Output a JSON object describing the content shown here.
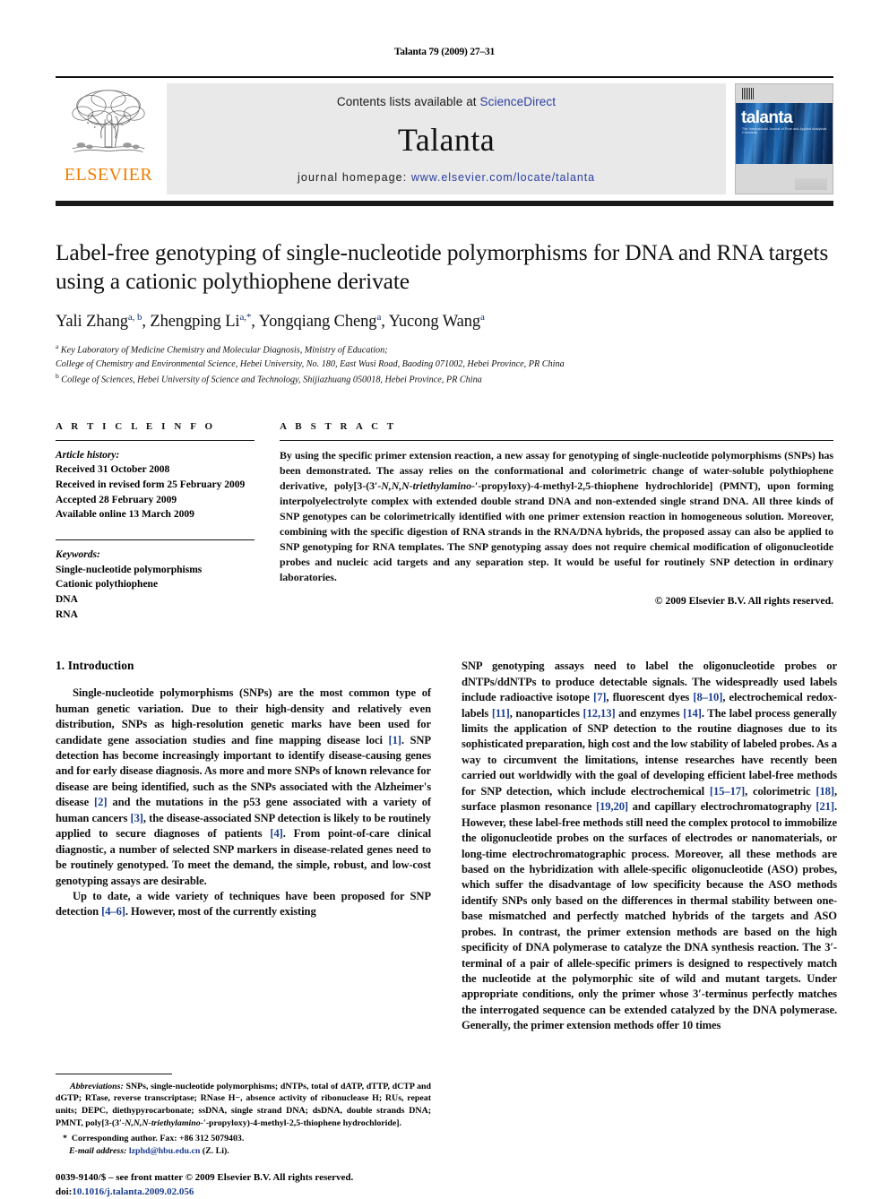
{
  "running_head": "Talanta 79 (2009) 27–31",
  "masthead": {
    "publisher_name": "ELSEVIER",
    "contents_prefix": "Contents lists available at ",
    "contents_link": "ScienceDirect",
    "journal_name": "Talanta",
    "homepage_prefix": "journal homepage: ",
    "homepage_link": "www.elsevier.com/locate/talanta",
    "cover_title": "talanta",
    "cover_subtitle": "The International Journal of Pure and Applied Analytical Chemistry",
    "link_color": "#2b3f9e",
    "elsevier_orange": "#F07D00"
  },
  "article": {
    "title": "Label-free genotyping of single-nucleotide polymorphisms for DNA and RNA targets using a cationic polythiophene derivate",
    "authors_html": "Yali Zhang<sup>a, b</sup>, Zhengping Li<sup>a,<span class=\"star\">*</span></sup>, Yongqiang Cheng<sup>a</sup>, Yucong Wang<sup>a</sup>",
    "affiliations": [
      "Key Laboratory of Medicine Chemistry and Molecular Diagnosis, Ministry of Education;",
      "College of Chemistry and Environmental Science, Hebei University, No. 180, East Wusi Road, Baoding 071002, Hebei Province, PR China",
      "College of Sciences, Hebei University of Science and Technology, Shijiazhuang 050018, Hebei Province, PR China"
    ],
    "affil_marks": [
      "a",
      "b"
    ]
  },
  "article_info": {
    "heading": "A R T I C L E   I N F O",
    "history_label": "Article history:",
    "history": [
      "Received 31 October 2008",
      "Received in revised form 25 February 2009",
      "Accepted 28 February 2009",
      "Available online 13 March 2009"
    ],
    "keywords_label": "Keywords:",
    "keywords": [
      "Single-nucleotide polymorphisms",
      "Cationic polythiophene",
      "DNA",
      "RNA"
    ]
  },
  "abstract": {
    "heading": "A B S T R A C T",
    "part1": "By using the specific primer extension reaction, a new assay for genotyping of single-nucleotide polymorphisms (SNPs) has been demonstrated. The assay relies on the conformational and colorimetric change of water-soluble polythiophene derivative, poly[3-(3",
    "part2": "-N,N,N-triethylamino-1",
    "part3": "-propyloxy)-4-methyl-2,5-thiophene hydrochloride] (PMNT), upon forming interpolyelectrolyte complex with extended double strand DNA and non-extended single strand DNA. All three kinds of SNP genotypes can be colorimetrically identified with one primer extension reaction in homogeneous solution. Moreover, combining with the specific digestion of RNA strands in the RNA/DNA hybrids, the proposed assay can also be applied to SNP genotyping for RNA templates. The SNP genotyping assay does not require chemical modification of oligonucleotide probes and nucleic acid targets and any separation step. It would be useful for routinely SNP detection in ordinary laboratories.",
    "copyright": "© 2009 Elsevier B.V. All rights reserved."
  },
  "introduction": {
    "section_title": "1.  Introduction",
    "para1_a": "Single-nucleotide polymorphisms (SNPs) are the most common type of human genetic variation. Due to their high-density and relatively even distribution, SNPs as high-resolution genetic marks have been used for candidate gene association studies and fine mapping disease loci ",
    "para1_ref1": "[1]",
    "para1_b": ". SNP detection has become increasingly important to identify disease-causing genes and for early disease diagnosis. As more and more SNPs of known relevance for disease are being identified, such as the SNPs associated with the Alzheimer's disease ",
    "para1_ref2": "[2]",
    "para1_c": " and the mutations in the p53 gene associated with a variety of human cancers ",
    "para1_ref3": "[3]",
    "para1_d": ", the disease-associated SNP detection is likely to be routinely applied to secure diagnoses of patients ",
    "para1_ref4": "[4]",
    "para1_e": ". From point-of-care clinical diagnostic, a number of selected SNP markers in disease-related genes need to be routinely genotyped. To meet the demand, the simple, robust, and low-cost genotyping assays are desirable.",
    "para2_a": "Up to date, a wide variety of techniques have been proposed for SNP detection ",
    "para2_ref1": "[4–6]",
    "para2_b": ". However, most of the currently existing SNP genotyping assays need to label the oligonucleotide probes or dNTPs/ddNTPs to produce detectable signals. The widespreadly used labels include radioactive isotope ",
    "para2_ref2": "[7]",
    "para2_c": ", fluorescent dyes ",
    "para2_ref3": "[8–10]",
    "para2_d": ", electrochemical redox-labels ",
    "para2_ref4": "[11]",
    "para2_e": ", nanoparticles ",
    "para2_ref5": "[12,13]",
    "para2_f": " and enzymes ",
    "para2_ref6": "[14]",
    "para2_g": ". The label process generally limits the application of SNP detection to the routine diagnoses due to its sophisticated preparation, high cost and the low stability of labeled probes. As a way to circumvent the limitations, intense researches have recently been carried out worldwidly with the goal of developing efficient label-free methods for SNP detection, which include electrochemical ",
    "para2_ref7": "[15–17]",
    "para2_h": ", colorimetric ",
    "para2_ref8": "[18]",
    "para2_i": ", surface plasmon resonance ",
    "para2_ref9": "[19,20]",
    "para2_j": " and capillary electrochromatography ",
    "para2_ref10": "[21]",
    "para2_k": ". However, these label-free methods still need the complex protocol to immobilize the oligonucleotide probes on the surfaces of electrodes or nanomaterials, or long-time electrochromatographic process. Moreover, all these methods are based on the hybridization with allele-specific oligonucleotide (ASO) probes, which suffer the disadvantage of low specificity because the ASO methods identify SNPs only based on the differences in thermal stability between one-base mismatched and perfectly matched hybrids of the targets and ASO probes. In contrast, the primer extension methods are based on the high specificity of DNA polymerase to catalyze the DNA synthesis reaction. The 3",
    "para2_l": "-terminal of a pair of allele-specific primers is designed to respectively match the nucleotide at the polymorphic site of wild and mutant targets. Under appropriate conditions, only the primer whose 3",
    "para2_m": "-terminus perfectly matches the interrogated sequence can be extended catalyzed by the DNA polymerase. Generally, the primer extension methods offer 10 times"
  },
  "footnote": {
    "abbrev_label": "Abbreviations:",
    "abbrev_text": "  SNPs, single-nucleotide polymorphisms; dNTPs, total of dATP, dTTP, dCTP and dGTP; RTase, reverse transcriptase; RNase H−, absence activity of ribonuclease H; RUs, repeat units; DEPC, diethypyrocarbonate; ssDNA, single strand DNA; dsDNA, double strands DNA; PMNT, poly[3-(3",
    "abbrev_text2": "-N,N,N-triethylamino-1",
    "abbrev_text3": "-propyloxy)-4-methyl-2,5-thiophene hydrochloride].",
    "corresponding_marker": "*",
    "corresponding": "Corresponding author. Fax: +86 312 5079403.",
    "email_label": "E-mail address:",
    "email": "lzphd@hbu.edu.cn",
    "email_suffix": " (Z. Li)."
  },
  "issn": {
    "line1": "0039-9140/$ – see front matter © 2009 Elsevier B.V. All rights reserved.",
    "doi_label": "doi:",
    "doi": "10.1016/j.talanta.2009.02.056"
  }
}
